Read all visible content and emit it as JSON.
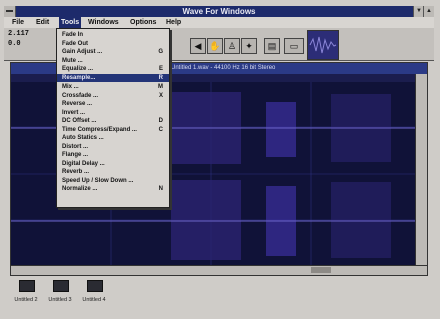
{
  "window": {
    "title": "Wave For Windows"
  },
  "menubar": {
    "items": [
      {
        "label": "File"
      },
      {
        "label": "Edit"
      },
      {
        "label": "Tools"
      },
      {
        "label": "Windows"
      },
      {
        "label": "Options"
      },
      {
        "label": "Help"
      }
    ],
    "active": "Tools"
  },
  "toolbar": {
    "readout_top": "2.117",
    "readout_bottom": "0.0",
    "icons": [
      "speaker-icon",
      "hand-icon",
      "person-icon",
      "marker-icon",
      "disk-icon"
    ]
  },
  "document": {
    "title": "Untitled 1.wav - 44100 Hz 16 bit Stereo"
  },
  "tools_menu": {
    "items": [
      {
        "label": "Fade In",
        "key": ""
      },
      {
        "label": "Fade Out",
        "key": ""
      },
      {
        "label": "Gain Adjust ...",
        "key": "G"
      },
      {
        "label": "Mute ...",
        "key": ""
      },
      {
        "label": "Equalize ...",
        "key": "E"
      },
      {
        "label": "Resample...",
        "key": "R",
        "highlight": true
      },
      {
        "label": "Mix ...",
        "key": "M"
      },
      {
        "label": "Crossfade ...",
        "key": "X"
      },
      {
        "label": "Reverse ...",
        "key": ""
      },
      {
        "label": "Invert ...",
        "key": ""
      },
      {
        "label": "DC Offset ...",
        "key": "D"
      },
      {
        "label": "Time Compress/Expand ...",
        "key": "C"
      },
      {
        "label": "Auto Statics ...",
        "key": ""
      },
      {
        "label": "Distort ...",
        "key": ""
      },
      {
        "label": "Flange ...",
        "key": ""
      },
      {
        "label": "Digital Delay ...",
        "key": ""
      },
      {
        "label": "Reverb ...",
        "key": ""
      },
      {
        "label": "Speed Up / Slow Down ...",
        "key": ""
      },
      {
        "label": "Normalize ...",
        "key": "N"
      }
    ]
  },
  "minimized": [
    {
      "label": "Untitled 2"
    },
    {
      "label": "Untitled 3"
    },
    {
      "label": "Untitled 4"
    }
  ],
  "colors": {
    "titlebar": "#1d2a6b",
    "waveform": "#3c2fa0",
    "wave_bg": "#101238"
  }
}
